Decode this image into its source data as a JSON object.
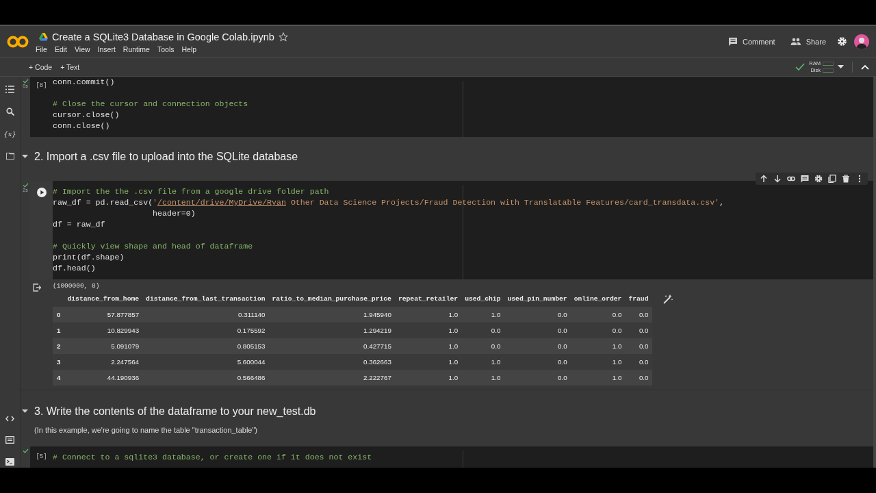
{
  "header": {
    "title": "Create a SQLite3 Database in Google Colab.ipynb",
    "menu": [
      "File",
      "Edit",
      "View",
      "Insert",
      "Runtime",
      "Tools",
      "Help"
    ],
    "actions": [
      {
        "kind": "comment",
        "label": "Comment"
      },
      {
        "kind": "share",
        "label": "Share"
      }
    ]
  },
  "toolbar": {
    "add_buttons": [
      "+ Code",
      "+ Text"
    ],
    "ram_label": "RAM",
    "disk_label": "Disk"
  },
  "sidebar": {
    "variables_glyph": "{x}"
  },
  "cells": [
    {
      "kind": "code",
      "focused": false,
      "exec_count": "[8]",
      "run_time": "0s",
      "done": true,
      "lines": [
        {
          "kind": "code",
          "segments": [
            {
              "kind": "plain",
              "text": "conn.commit()"
            }
          ]
        },
        {
          "kind": "blank"
        },
        {
          "kind": "code",
          "segments": [
            {
              "kind": "comment",
              "text": "# Close the cursor and connection objects"
            }
          ]
        },
        {
          "kind": "code",
          "segments": [
            {
              "kind": "plain",
              "text": "cursor.close()"
            }
          ]
        },
        {
          "kind": "code",
          "segments": [
            {
              "kind": "plain",
              "text": "conn.close()"
            }
          ]
        }
      ]
    },
    {
      "kind": "heading",
      "text": "2. Import a .csv file to upload into the SQLite database",
      "expanded": true
    },
    {
      "kind": "code",
      "focused": true,
      "run_time": "2s",
      "done": true,
      "lines": [
        {
          "kind": "code",
          "segments": [
            {
              "kind": "comment",
              "text": "# Import the the .csv file from a google drive folder path"
            }
          ]
        },
        {
          "kind": "code",
          "segments": [
            {
              "kind": "plain",
              "text": "raw_df = pd.read_csv("
            },
            {
              "kind": "string",
              "text": "'"
            },
            {
              "kind": "link",
              "text": "/content/drive/MyDrive/Ryan"
            },
            {
              "kind": "string",
              "text": " Other Data Science Projects/Fraud Detection with Translatable Features/card_transdata.csv'"
            },
            {
              "kind": "plain",
              "text": ","
            }
          ]
        },
        {
          "kind": "code",
          "segments": [
            {
              "kind": "plain",
              "text": "                     header=0)"
            }
          ]
        },
        {
          "kind": "code",
          "segments": [
            {
              "kind": "plain",
              "text": "df = raw_df"
            }
          ]
        },
        {
          "kind": "blank"
        },
        {
          "kind": "code",
          "segments": [
            {
              "kind": "comment",
              "text": "# Quickly view shape and head of dataframe"
            }
          ]
        },
        {
          "kind": "code",
          "segments": [
            {
              "kind": "plain",
              "text": "print(df.shape)"
            }
          ]
        },
        {
          "kind": "code",
          "segments": [
            {
              "kind": "plain",
              "text": "df.head()"
            }
          ]
        }
      ],
      "output": {
        "text": "(1000000, 8)",
        "table": {
          "columns": [
            "distance_from_home",
            "distance_from_last_transaction",
            "ratio_to_median_purchase_price",
            "repeat_retailer",
            "used_chip",
            "used_pin_number",
            "online_order",
            "fraud"
          ],
          "rows": [
            {
              "index": "0",
              "values": [
                "57.877857",
                "0.311140",
                "1.945940",
                "1.0",
                "1.0",
                "0.0",
                "0.0",
                "0.0"
              ]
            },
            {
              "index": "1",
              "values": [
                "10.829943",
                "0.175592",
                "1.294219",
                "1.0",
                "0.0",
                "0.0",
                "0.0",
                "0.0"
              ]
            },
            {
              "index": "2",
              "values": [
                "5.091079",
                "0.805153",
                "0.427715",
                "1.0",
                "0.0",
                "0.0",
                "1.0",
                "0.0"
              ]
            },
            {
              "index": "3",
              "values": [
                "2.247564",
                "5.600044",
                "0.362663",
                "1.0",
                "1.0",
                "0.0",
                "1.0",
                "0.0"
              ]
            },
            {
              "index": "4",
              "values": [
                "44.190936",
                "0.566486",
                "2.222767",
                "1.0",
                "1.0",
                "0.0",
                "1.0",
                "0.0"
              ]
            }
          ]
        }
      }
    },
    {
      "kind": "heading",
      "text": "3. Write the contents of the dataframe to your new_test.db",
      "expanded": true
    },
    {
      "kind": "text",
      "text": "(In this example, we're going to name the table \"transaction_table\")"
    },
    {
      "kind": "code",
      "focused": false,
      "exec_count": "[5]",
      "done": true,
      "lines": [
        {
          "kind": "code",
          "segments": [
            {
              "kind": "comment",
              "text": "# Connect to a sqlite3 database, or create one if it does not exist"
            }
          ]
        }
      ]
    }
  ]
}
